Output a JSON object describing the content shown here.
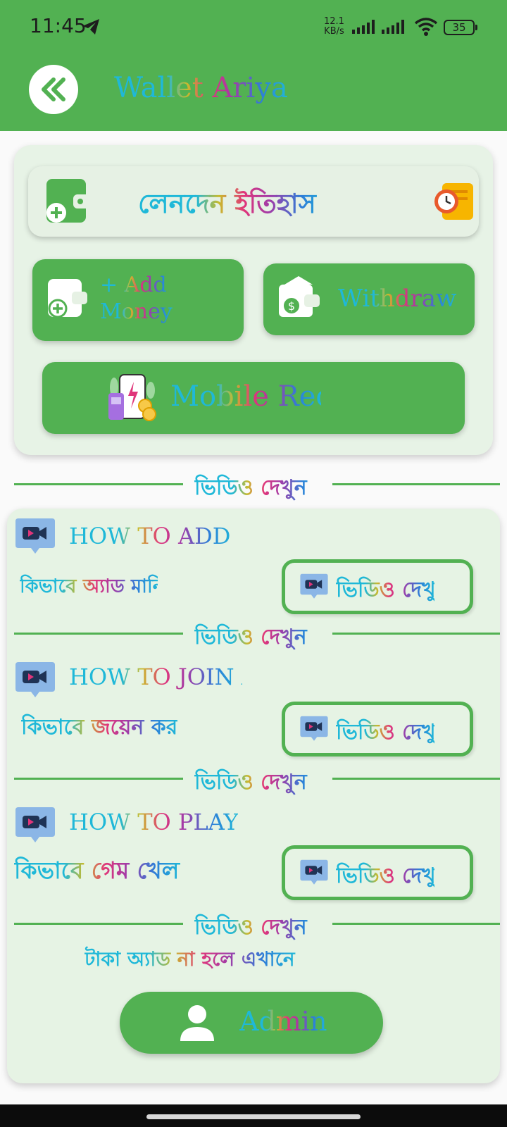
{
  "status_bar": {
    "time": "11:45",
    "net_speed_value": "12.1",
    "net_speed_unit": "KB/s",
    "battery": "35"
  },
  "app_bar": {
    "title": "Wallet Ariya",
    "back_icon": "double-chevron-left-icon"
  },
  "actions": {
    "history_label": "লেনদেন ইতিহাস",
    "add_money_label": "+ Add\nMoney",
    "withdraw_label": "Withdraw",
    "mobile_recharge_label": "Mobile Recharge"
  },
  "divider_label": "ভিডিও দেখুন",
  "videos": [
    {
      "title": "HOW TO ADD MONEY",
      "subtitle": "কিভাবে অ্যাড মানি",
      "button_label": "ভিডিও দেখুন"
    },
    {
      "title": "HOW TO JOIN A",
      "subtitle": "কিভাবে জয়েন করবেন",
      "button_label": "ভিডিও দেখুন"
    },
    {
      "title": "HOW TO PLAY",
      "subtitle": "কিভাবে গেম খেলবেন",
      "button_label": "ভিডিও দেখুন"
    }
  ],
  "note": "টাকা অ্যাড না হলে এখানে",
  "admin_label": "Admin",
  "colors": {
    "primary_green": "#52b152",
    "card_bg": "#e6f3e4",
    "text_cyan": "#1fb8d8"
  }
}
